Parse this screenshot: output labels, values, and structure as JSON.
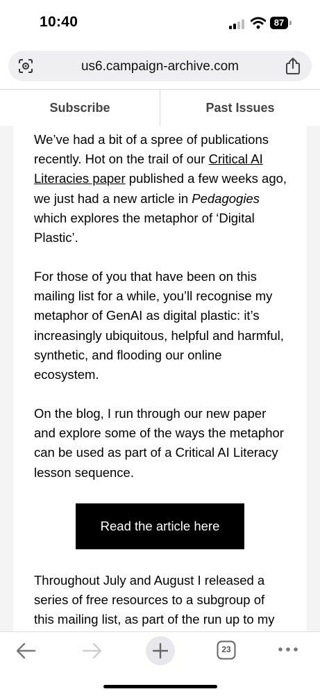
{
  "status_bar": {
    "time": "10:40",
    "battery": "87",
    "signal_icon": "signal-bars-icon",
    "wifi_icon": "wifi-icon"
  },
  "browser": {
    "url": "us6.campaign-archive.com",
    "tab_count": "23",
    "icons": [
      "lens-icon",
      "share-icon",
      "back-arrow-icon",
      "forward-arrow-icon",
      "plus-icon",
      "tabs-icon",
      "more-icon"
    ]
  },
  "nav": {
    "subscribe": "Subscribe",
    "past_issues": "Past Issues"
  },
  "article": {
    "p1_intro": "We’ve had a bit of a spree of publications recently. Hot on the trail of our ",
    "p1_link": "Critical AI Literacies paper",
    "p1_mid": " published a few weeks ago, we just had a new article in ",
    "p1_italic": "Pedagogies",
    "p1_end": " which explores the metaphor of ‘Digital Plastic’.",
    "p2": "For those of you that have been on this mailing list for a while, you’ll recognise my metaphor of GenAI as digital plastic: it’s increasingly ubiquitous, helpful and harmful, synthetic, and flooding our online ecosystem.",
    "p3": "On the blog, I run through our new paper and explore some of the ways the metaphor can be used as part of a Critical AI Literacy lesson sequence.",
    "cta": "Read the article here",
    "p4": "Throughout July and August I released a series of free resources to a subgroup of this mailing list, as part of the run up to my"
  },
  "colors": {
    "cta_bg": "#000000",
    "page_bg": "#f4f4f4",
    "url_bar_bg": "#efeff1"
  }
}
